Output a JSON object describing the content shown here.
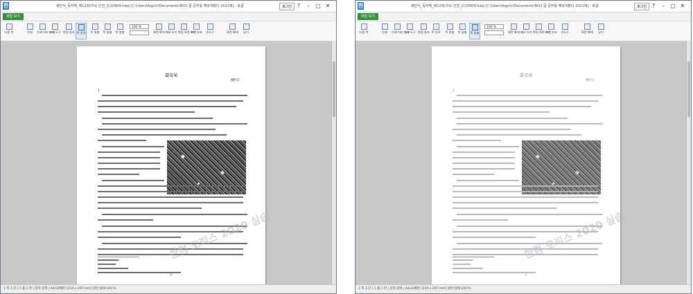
{
  "windows": [
    {
      "title": "쾌만식_독자해_제12회(지도 인천_2)10909.hwp [C:\\Users\\lkgs\\n\\Documents\\NO2 글 공부를 해보까봤다 2021에] - 호글",
      "login_label": "로그인",
      "menu_tab": "파일 보기",
      "ribbon": [
        {
          "label": "다음 쪽"
        },
        {
          "label": "인쇄"
        },
        {
          "label": "인쇄 미리 보기"
        },
        {
          "label": "인쇄 도구"
        },
        {
          "label": "편집 용지"
        },
        {
          "label": "쪽 윤곽"
        },
        {
          "label": "폭 맞춤"
        },
        {
          "label": "쪽 맞춤"
        },
        {
          "label": "쪽 맞춤"
        },
        {
          "label": "화면 확대"
        },
        {
          "label": "메모 보기"
        },
        {
          "label": "편집 화면 보기"
        },
        {
          "label": "조판 부호"
        },
        {
          "label": "순도구"
        },
        {
          "label": "화면 확대"
        },
        {
          "label": "닫기"
        }
      ],
      "zoom_value": "100 %",
      "doc": {
        "title": "화국새",
        "author": "채만식",
        "section": "1",
        "page_number": "1"
      },
      "watermark": "한컴 오피스 2020 실습",
      "status": "1 쪽 1 단 | 1 줄 1 칸 | 문자 입력 | A4(국배판) [210 x 297 mm] 원만 형태 100 %"
    },
    {
      "title": "쾌만식_독자해_제12회(지도 인천_2)10909.hwp [C:\\Users\\lkgs\\n\\Documents\\NO2 글 공부를 해보까봤다 2021에] - 호글",
      "login_label": "로그인",
      "menu_tab": "파일 보기",
      "ribbon": [
        {
          "label": "다음 쪽"
        },
        {
          "label": "인쇄"
        },
        {
          "label": "인쇄 미리 보기"
        },
        {
          "label": "인쇄 도구"
        },
        {
          "label": "편집 용지"
        },
        {
          "label": "쪽 윤곽"
        },
        {
          "label": "폭 맞춤"
        },
        {
          "label": "쪽 맞춤"
        },
        {
          "label": "쪽 맞춤"
        },
        {
          "label": "화면 확대"
        },
        {
          "label": "메모 보기"
        },
        {
          "label": "편집 화면 보기"
        },
        {
          "label": "조판 부호"
        },
        {
          "label": "순도구"
        },
        {
          "label": "화면 확대"
        },
        {
          "label": "닫기"
        }
      ],
      "zoom_value": "100 %",
      "doc": {
        "title": "화국새",
        "author": "채만식",
        "section": "1",
        "page_number": "1"
      },
      "watermark": "한컴 오피스 2020 실습",
      "status": "1 쪽 1 단 | 1 줄 1 칸 | 문자 입력 | A4(국배판) [210 x 297 mm] 원만 형태 100 %"
    }
  ]
}
